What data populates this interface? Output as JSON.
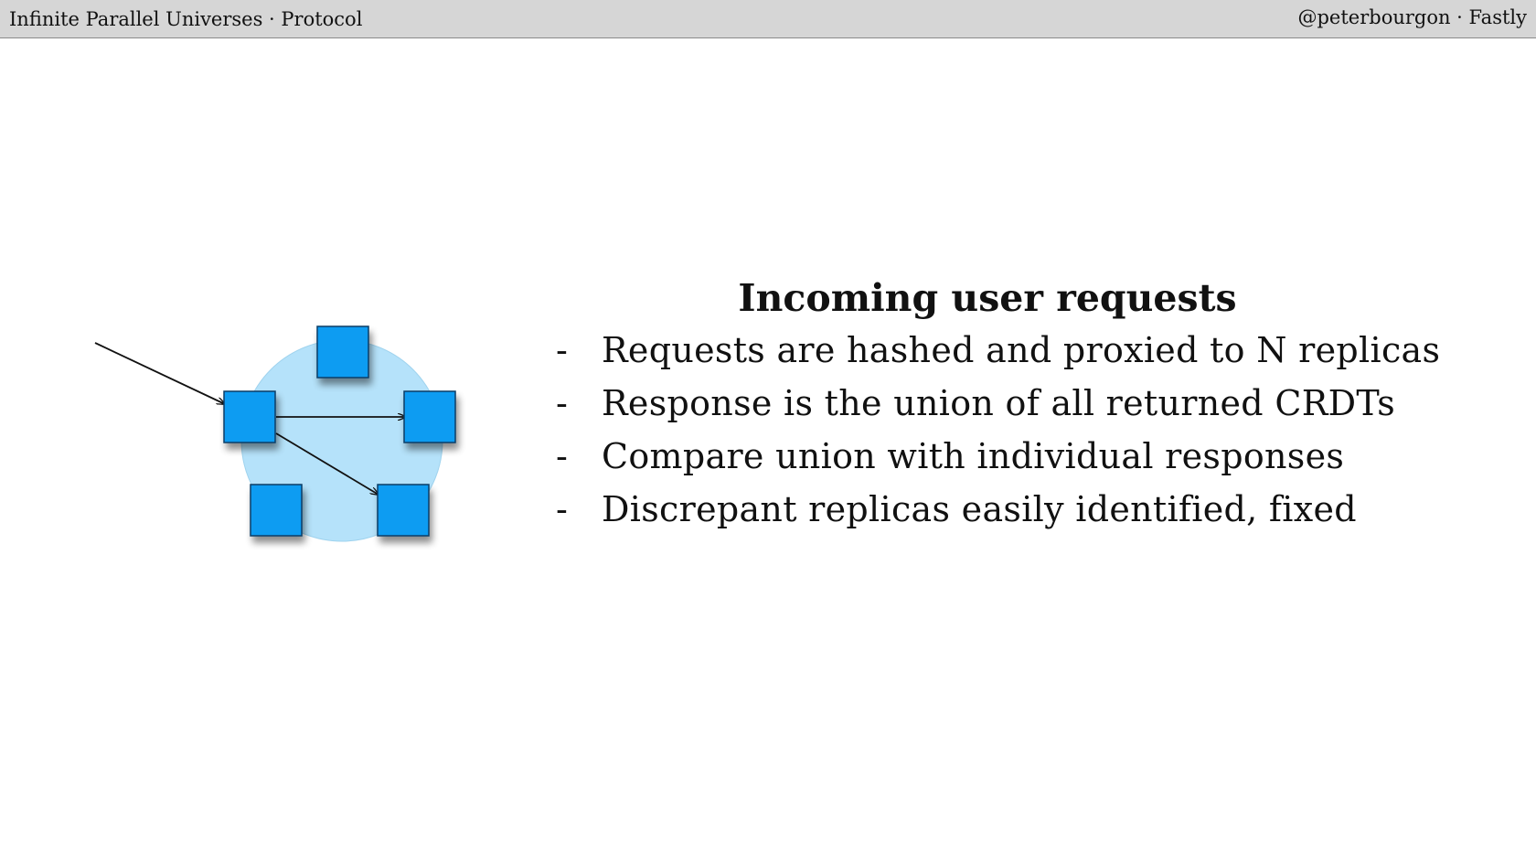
{
  "header": {
    "left": "Infinite Parallel Universes · Protocol",
    "right": "@peterbourgon · Fastly"
  },
  "slide": {
    "title": "Incoming user requests",
    "bullets": [
      {
        "dash": "-",
        "text": "Requests are hashed and proxied to N replicas"
      },
      {
        "dash": "-",
        "text": "Response is the union of all returned CRDTs"
      },
      {
        "dash": "-",
        "text": "Compare union with individual responses"
      },
      {
        "dash": "-",
        "text": "Discrepant replicas easily identified, fixed"
      }
    ]
  },
  "diagram": {
    "ring_color": "#b5e2fa",
    "node_color": "#0a9cf2",
    "node_count": 5,
    "arrow_count": 3
  }
}
